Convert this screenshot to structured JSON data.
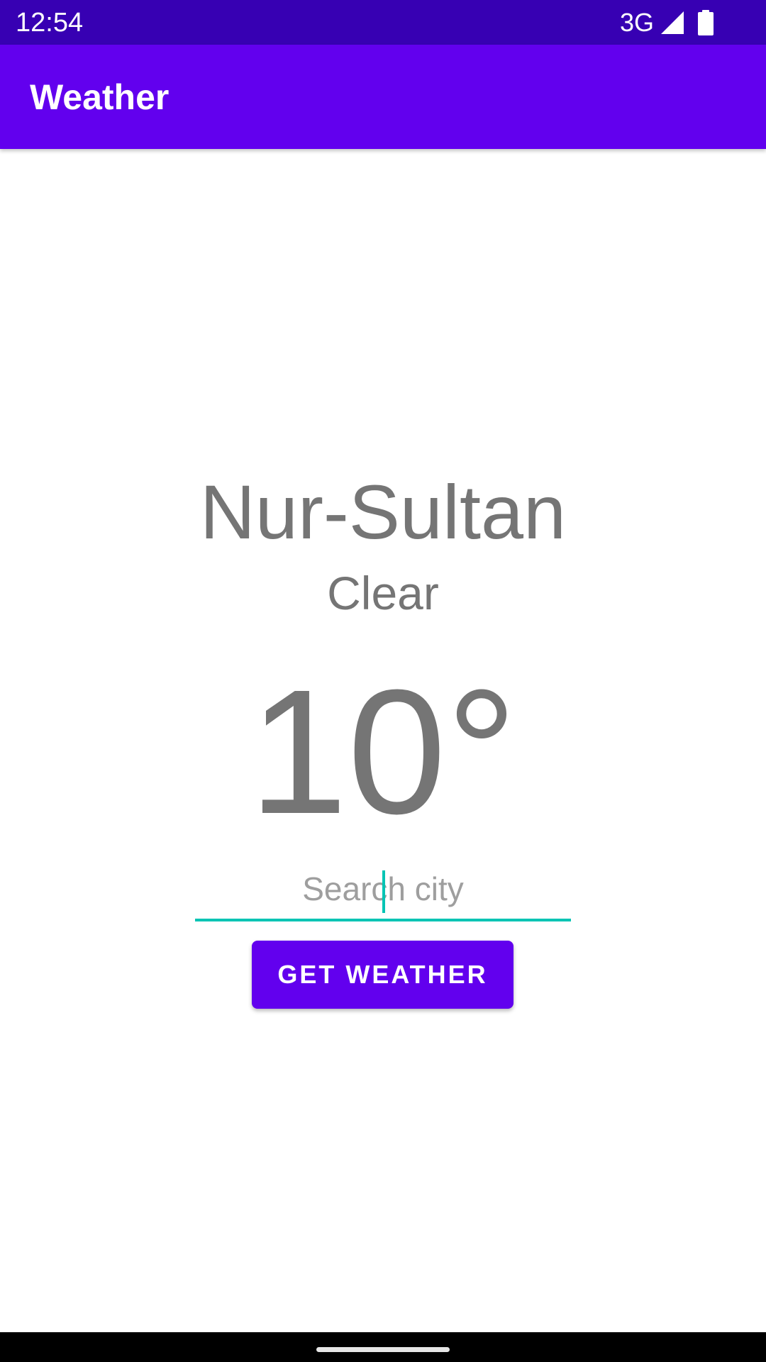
{
  "status_bar": {
    "time": "12:54",
    "network": "3G",
    "signal_icon": "cellular-signal-icon",
    "battery_icon": "battery-full-icon"
  },
  "app_bar": {
    "title": "Weather"
  },
  "weather": {
    "city": "Nur-Sultan",
    "condition": "Clear",
    "temperature": "10°"
  },
  "search": {
    "placeholder": "Search city",
    "value": ""
  },
  "actions": {
    "get_weather_label": "GET WEATHER"
  },
  "colors": {
    "status_bar": "#3700b3",
    "primary": "#6200ee",
    "accent": "#03c4b4",
    "text_secondary": "#757575"
  }
}
